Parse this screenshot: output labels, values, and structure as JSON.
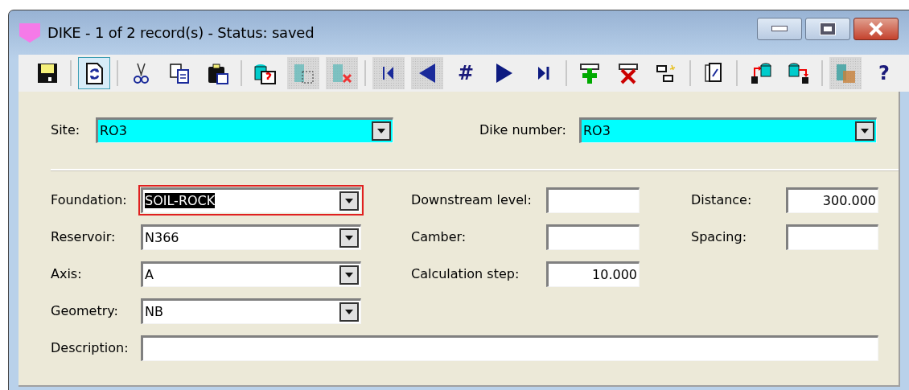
{
  "window": {
    "title": "DIKE - 1 of 2 record(s) - Status: saved"
  },
  "toolbar": [
    {
      "kind": "save",
      "pressed": false,
      "disabled": false
    },
    {
      "kind": "separator"
    },
    {
      "kind": "refresh",
      "pressed": true,
      "disabled": false
    },
    {
      "kind": "separator"
    },
    {
      "kind": "cut",
      "pressed": false,
      "disabled": false
    },
    {
      "kind": "copy",
      "pressed": false,
      "disabled": false
    },
    {
      "kind": "paste",
      "pressed": false,
      "disabled": false
    },
    {
      "kind": "separator"
    },
    {
      "kind": "db-query",
      "pressed": false,
      "disabled": false
    },
    {
      "kind": "db-grid",
      "pressed": false,
      "disabled": true
    },
    {
      "kind": "db-delete",
      "pressed": false,
      "disabled": true
    },
    {
      "kind": "separator"
    },
    {
      "kind": "first",
      "pressed": false,
      "disabled": true
    },
    {
      "kind": "prev",
      "pressed": false,
      "disabled": true
    },
    {
      "kind": "text",
      "label": "#",
      "pressed": false,
      "disabled": false
    },
    {
      "kind": "next",
      "pressed": false,
      "disabled": false
    },
    {
      "kind": "last",
      "pressed": false,
      "disabled": false
    },
    {
      "kind": "separator"
    },
    {
      "kind": "add",
      "pressed": false,
      "disabled": false
    },
    {
      "kind": "delete",
      "pressed": false,
      "disabled": false
    },
    {
      "kind": "swap",
      "pressed": false,
      "disabled": false
    },
    {
      "kind": "separator"
    },
    {
      "kind": "docs",
      "pressed": false,
      "disabled": false
    },
    {
      "kind": "separator"
    },
    {
      "kind": "import",
      "pressed": false,
      "disabled": false
    },
    {
      "kind": "export",
      "pressed": false,
      "disabled": false
    },
    {
      "kind": "separator"
    },
    {
      "kind": "db-table",
      "pressed": false,
      "disabled": true
    },
    {
      "kind": "text",
      "label": "?",
      "pressed": false,
      "disabled": false
    }
  ],
  "header_fields": [
    {
      "label": "Site:",
      "value": "RO3",
      "kind": "combo",
      "highlighted": true
    },
    {
      "label": "Dike number:",
      "value": "RO3",
      "kind": "combo",
      "highlighted": true
    }
  ],
  "rows": [
    [
      {
        "label": "Foundation:",
        "value": "SOIL-ROCK",
        "kind": "combo",
        "focused": true,
        "text_selected": true
      },
      {
        "label": "Downstream level:",
        "kind": "number"
      },
      {
        "label": "Distance:",
        "value": "300.000",
        "kind": "number"
      }
    ],
    [
      {
        "label": "Reservoir:",
        "value": "N366",
        "kind": "combo"
      },
      {
        "label": "Camber:",
        "kind": "number"
      },
      {
        "label": "Spacing:",
        "kind": "number"
      }
    ],
    [
      {
        "label": "Axis:",
        "value": "A",
        "kind": "combo"
      },
      {
        "label": "Calculation step:",
        "value": "10.000",
        "kind": "number"
      }
    ],
    [
      {
        "label": "Geometry:",
        "value": "NB",
        "kind": "combo"
      }
    ],
    [
      {
        "label": "Description:",
        "kind": "wide"
      }
    ]
  ]
}
